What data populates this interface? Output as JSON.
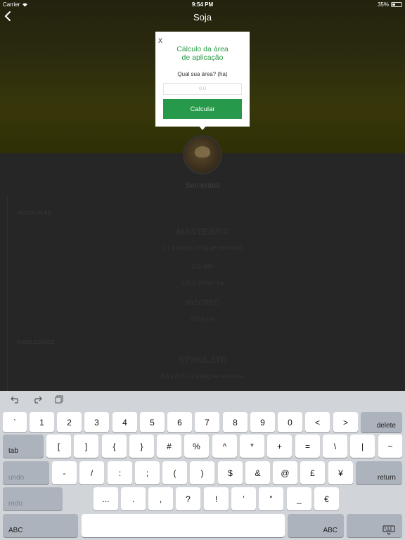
{
  "status": {
    "carrier": "Carrier",
    "time": "9:54 PM",
    "battery": "35%",
    "battery_level": 0.35
  },
  "nav": {
    "title": "Soja",
    "back_icon": "chevron-left-icon"
  },
  "content": {
    "category_label": "Sementes",
    "sections": [
      {
        "heading": "INOCULAÇÃO",
        "items": [
          {
            "brand": "MASTERFIX",
            "dose": "1 x 1 doses / 50kg de sementes"
          },
          {
            "brand": "Co-Mo",
            "dose": "100 a 200ml / ha"
          },
          {
            "brand": "RIZOTEC",
            "dose": "200 g / ha"
          }
        ]
      },
      {
        "heading": "FISIOLÓGICOS",
        "items": [
          {
            "brand": "STIMULATE",
            "dose": "0,5 a 0,75 L / 100kg de sementes"
          }
        ]
      }
    ]
  },
  "modal": {
    "close_label": "X",
    "title_line1": "Cálculo da área",
    "title_line2": "de aplicação",
    "area_label": "Qual sua área? (ha)",
    "area_value": "",
    "area_placeholder": "0.0",
    "calc_button": "Calcular"
  },
  "keyboard": {
    "toolbar": [
      "undo-arrow-icon",
      "redo-arrow-icon",
      "clipboard-icon"
    ],
    "row1": [
      "`",
      "1",
      "2",
      "3",
      "4",
      "5",
      "6",
      "7",
      "8",
      "9",
      "0",
      "<",
      ">"
    ],
    "delete": "delete",
    "tab": "tab",
    "row2": [
      "[",
      "]",
      "{",
      "}",
      "#",
      "%",
      "^",
      "*",
      "+",
      "=",
      "\\",
      "|",
      "~"
    ],
    "undo": "undo",
    "row3": [
      "-",
      "/",
      ":",
      ";",
      "(",
      ")",
      "$",
      "&",
      "@",
      "£",
      "¥"
    ],
    "return": "return",
    "redo": "redo",
    "row4": [
      "...",
      ".",
      ",",
      "?",
      "!",
      "’",
      "”",
      "_",
      "€"
    ],
    "abc_left": "ABC",
    "abc_right": "ABC",
    "hide_icon": "keyboard-hide-icon"
  }
}
